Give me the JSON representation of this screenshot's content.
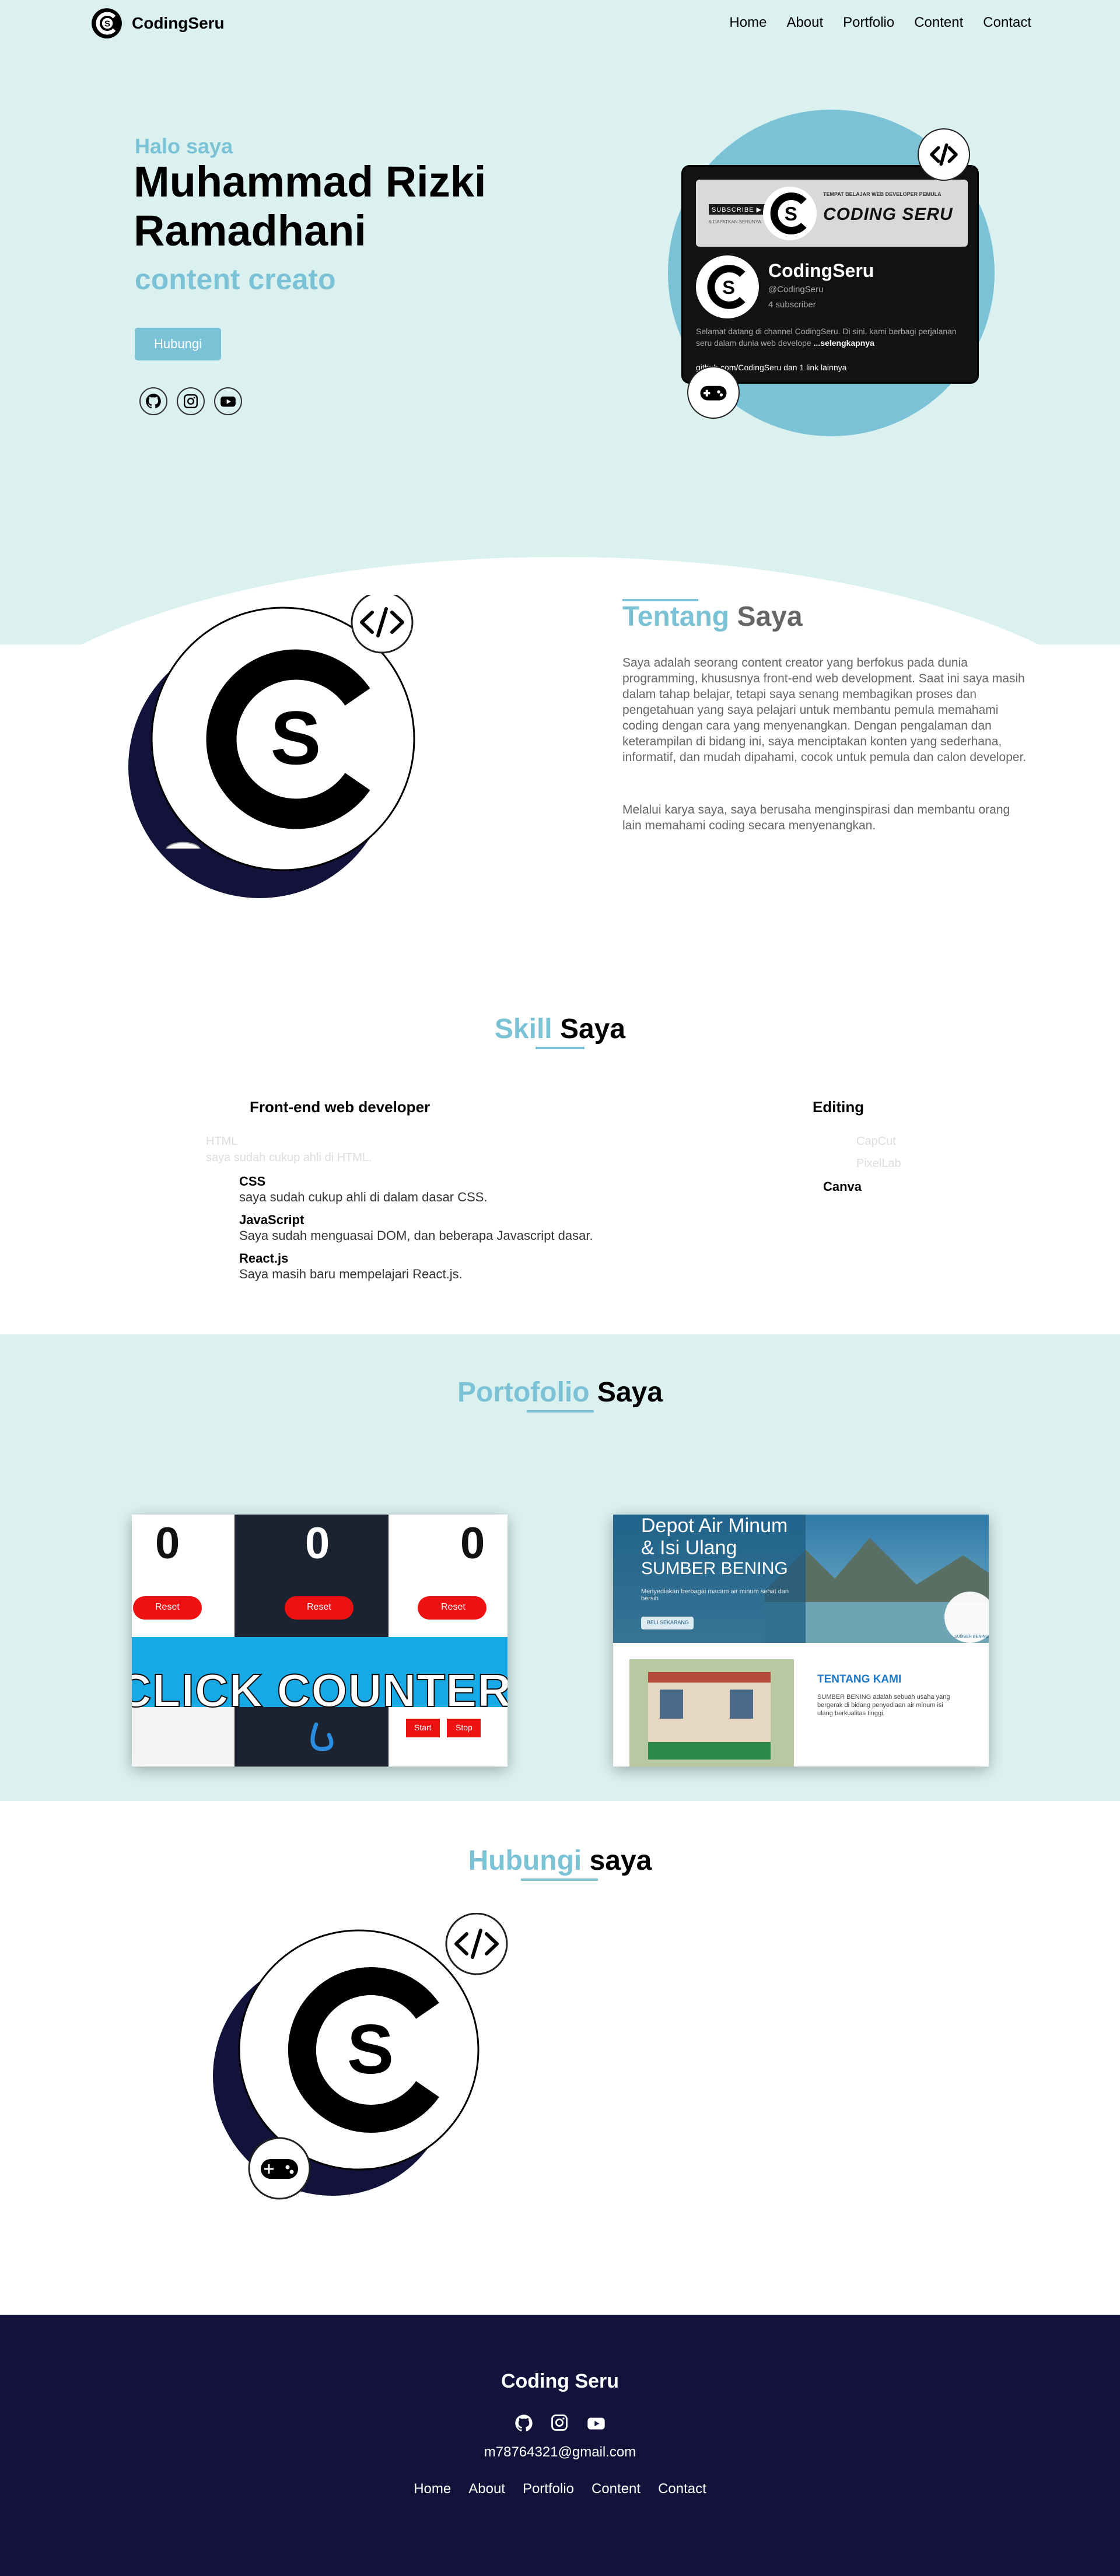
{
  "brand": {
    "name": "CodingSeru"
  },
  "nav": {
    "items": [
      "Home",
      "About",
      "Portfolio",
      "Content",
      "Contact"
    ]
  },
  "hero": {
    "greeting": "Halo saya",
    "name": "Muhammad Rizki Ramadhani",
    "role": "content creato",
    "button": "Hubungi"
  },
  "youtube_card": {
    "banner_subscribe": "SUBSCRIBE ▶",
    "banner_tagline": "TEMPAT BELAJAR WEB DEVELOPER PEMULA",
    "banner_small": "& DAPATKAN SERUNYA",
    "banner_title": "CODING SERU",
    "channel_name": "CodingSeru",
    "handle": "@CodingSeru",
    "subscribers": "4 subscriber",
    "description": "Selamat datang di channel CodingSeru. Di sini, kami berbagi perjalanan seru dalam dunia web develope",
    "more": "...selengkapnya",
    "link": "github.com/CodingSeru dan 1 link lainnya"
  },
  "about": {
    "title_accent": "Tentang",
    "title_rest": "Saya",
    "paragraph1": "Saya adalah seorang content creator yang berfokus pada dunia programming, khususnya front-end web development. Saat ini saya masih dalam tahap belajar, tetapi saya senang membagikan proses dan pengetahuan yang saya pelajari untuk membantu pemula memahami coding dengan cara yang menyenangkan. Dengan pengalaman dan keterampilan di bidang ini, saya menciptakan konten yang sederhana, informatif, dan mudah dipahami, cocok untuk pemula dan calon developer.",
    "paragraph2": "Melalui karya saya, saya berusaha menginspirasi dan membantu orang lain memahami coding secara menyenangkan."
  },
  "skill": {
    "title_accent": "Skill",
    "title_rest": "Saya",
    "frontend_title": "Front-end web developer",
    "editing_title": "Editing",
    "faded_left": [
      "HTML",
      "saya sudah cukup ahli di HTML."
    ],
    "faded_right": [
      "CapCut",
      "PixelLab"
    ],
    "canva": "Canva",
    "items": [
      {
        "name": "CSS",
        "desc": "saya sudah cukup ahli di dalam dasar CSS."
      },
      {
        "name": "JavaScript",
        "desc": "Saya sudah menguasai DOM, dan beberapa Javascript dasar."
      },
      {
        "name": "React.js",
        "desc": "Saya masih baru mempelajari React.js."
      }
    ]
  },
  "portfolio": {
    "title_accent": "Portofolio",
    "title_rest": "Saya",
    "counter": {
      "digits": [
        "0",
        "0",
        "0"
      ],
      "reset": "Reset",
      "overlay": "CLICK COUNTER",
      "start": "Start",
      "stop": "Stop"
    },
    "depot": {
      "heading1": "Depot Air Minum",
      "heading2": "& Isi Ulang",
      "heading3": "SUMBER BENING",
      "blurb": "Menyediakan berbagai macam air minum sehat dan bersih",
      "button": "BELI SEKARANG",
      "about_title": "TENTANG KAMI",
      "about_text": "SUMBER BENING adalah sebuah usaha yang bergerak di bidang penyediaan air minum isi ulang berkualitas tinggi.",
      "brand": "SUMBER BENING"
    }
  },
  "contact": {
    "title_accent": "Hubungi",
    "title_rest": "saya"
  },
  "footer": {
    "title": "Coding Seru",
    "email": "m78764321@gmail.com",
    "nav": [
      "Home",
      "About",
      "Portfolio",
      "Content",
      "Contact"
    ]
  },
  "colors": {
    "accent": "#7cc2d6",
    "mint_bg": "#dbf1f0",
    "navy": "#12123a",
    "text_gray": "#666666"
  }
}
